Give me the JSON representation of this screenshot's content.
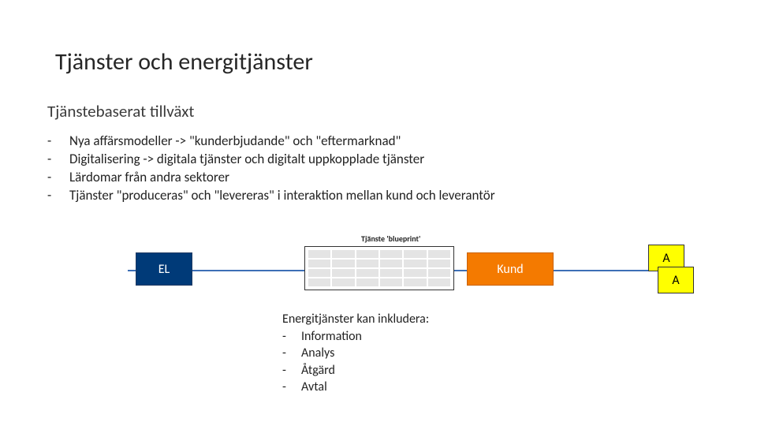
{
  "title": "Tjänster och energitjänster",
  "subtitle": "Tjänstebaserat tillväxt",
  "bullets": [
    "Nya affärsmodeller -> \"kunderbjudande\" och \"eftermarknad\"",
    "Digitalisering -> digitala tjänster och digitalt uppkopplade tjänster",
    "Lärdomar från andra sektorer",
    "Tjänster \"produceras\" och \"levereras\" i interaktion mellan kund och leverantör"
  ],
  "diagram": {
    "blueprint_label": "Tjänste 'blueprint'",
    "box_el": "EL",
    "box_kund": "Kund",
    "box_a1": "A",
    "box_a2": "A"
  },
  "includes": {
    "heading": "Energitjänster kan inkludera:",
    "items": [
      "Information",
      "Analys",
      "Åtgärd",
      "Avtal"
    ]
  }
}
